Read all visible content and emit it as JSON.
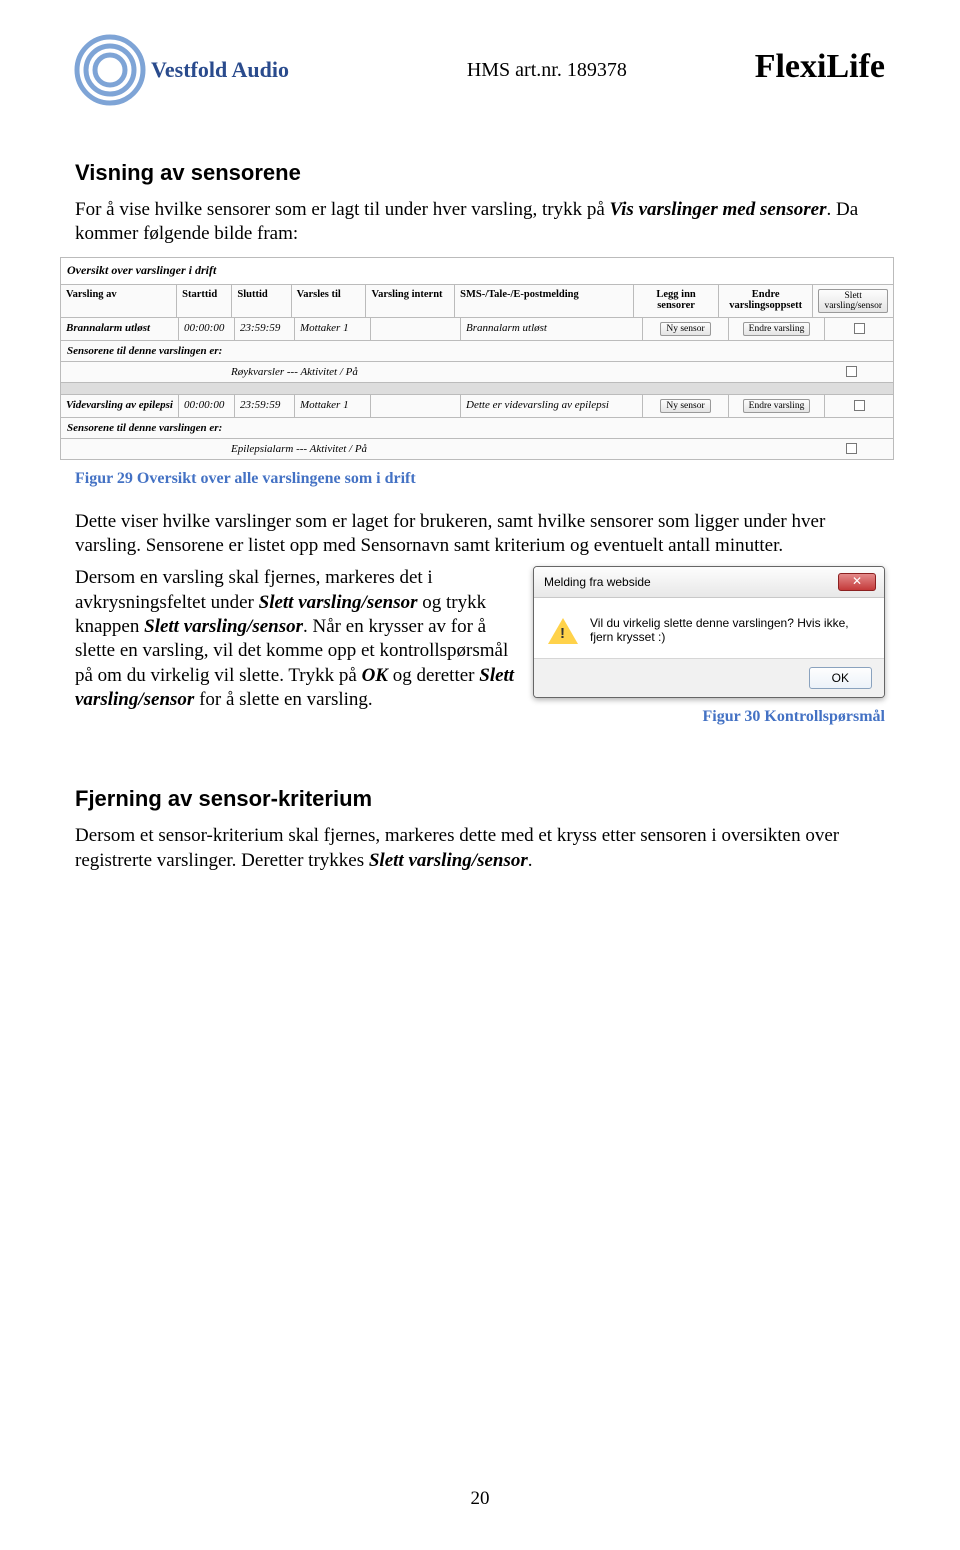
{
  "header": {
    "logo_text": "Vestfold Audio",
    "hms": "HMS art.nr. 189378",
    "brand": "FlexiLife"
  },
  "section1": {
    "title": "Visning av sensorene",
    "intro_a": "For å vise hvilke sensorer som er lagt til under hver varsling, trykk på ",
    "intro_b": "Vis varslinger med sensorer",
    "intro_c": ". Da kommer følgende bilde fram:"
  },
  "table": {
    "title": "Oversikt over varslinger i drift",
    "headers": [
      "Varsling av",
      "Starttid",
      "Sluttid",
      "Varsles til",
      "Varsling internt",
      "SMS-/Tale-/E-postmelding",
      "Legg inn sensorer",
      "Endre varslingsoppsett"
    ],
    "header_btn": "Slett varsling/sensor",
    "row1": {
      "a": "Brannalarm utløst",
      "start": "00:00:00",
      "stop": "23:59:59",
      "mottaker": "Mottaker 1",
      "msg": "Brannalarm utløst",
      "btn1": "Ny sensor",
      "btn2": "Endre varsling"
    },
    "sensors_label": "Sensorene til denne varslingen er:",
    "sensor1": "Røykvarsler --- Aktivitet / På",
    "row2": {
      "a": "Videvarsling av epilepsi",
      "start": "00:00:00",
      "stop": "23:59:59",
      "mottaker": "Mottaker 1",
      "msg": "Dette er videvarsling av epilepsi",
      "btn1": "Ny sensor",
      "btn2": "Endre varsling"
    },
    "sensor2": "Epilepsialarm --- Aktivitet / På"
  },
  "fig29": "Figur 29 Oversikt over alle varslingene som i drift",
  "para2": "Dette viser hvilke varslinger som er laget for brukeren, samt hvilke sensorer som ligger under hver varsling. Sensorene er listet opp med Sensornavn samt kriterium og eventuelt antall minutter.",
  "para3": {
    "t1": "Dersom en varsling skal fjernes, markeres det i avkrysningsfeltet under ",
    "b1": "Slett varsling/sensor",
    "t2": " og trykk knappen ",
    "b2": "Slett varsling/sensor",
    "t3": ". Når en krysser av for å slette en varsling, vil det komme opp et kontrollspørsmål på om du virkelig vil slette. Trykk på ",
    "b3": "OK",
    "t4": " og deretter ",
    "b4": "Slett varsling/sensor",
    "t5": " for å slette en varsling."
  },
  "dialog": {
    "title": "Melding fra webside",
    "body": "Vil du virkelig slette denne varslingen? Hvis ikke, fjern krysset :)",
    "ok": "OK"
  },
  "fig30": "Figur 30 Kontrollspørsmål",
  "section2": {
    "title": "Fjerning av sensor-kriterium",
    "t1": "Dersom et sensor-kriterium skal fjernes, markeres dette med et kryss etter sensoren i oversikten over registrerte varslinger. Deretter trykkes ",
    "b1": "Slett varsling/sensor",
    "t2": "."
  },
  "page_number": "20"
}
